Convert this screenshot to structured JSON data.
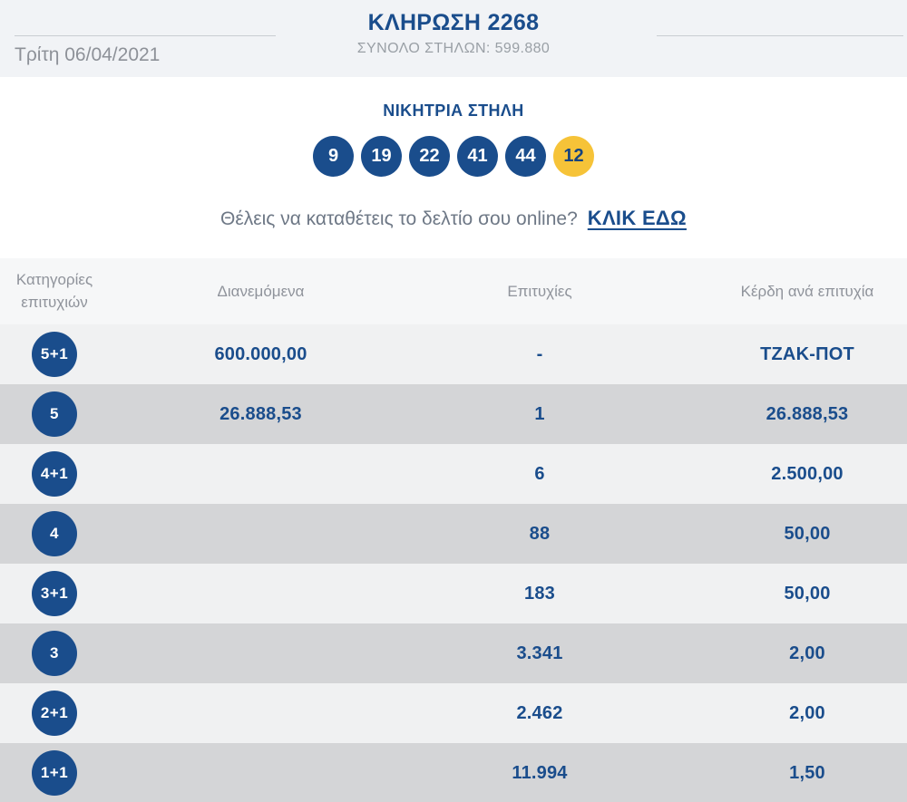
{
  "colors": {
    "brand_blue": "#1a4d8c",
    "joker_yellow": "#f6c338"
  },
  "header": {
    "title": "ΚΛΗΡΩΣΗ 2268",
    "date": "Τρίτη 06/04/2021",
    "columns_total": "ΣΥΝΟΛΟ ΣΤΗΛΩΝ: 599.880"
  },
  "winning": {
    "title": "ΝΙΚΗΤΡΙΑ ΣΤΗΛΗ",
    "numbers": [
      "9",
      "19",
      "22",
      "41",
      "44"
    ],
    "joker": "12"
  },
  "online": {
    "question": "Θέλεις να καταθέτεις το δελτίο σου online?",
    "link_label": "ΚΛΙΚ ΕΔΩ"
  },
  "table": {
    "headers": {
      "category": "Κατηγορίες επιτυχιών",
      "distributed": "Διανεμόμενα",
      "winners": "Επιτυχίες",
      "prize": "Κέρδη ανά επιτυχία"
    },
    "rows": [
      {
        "category": "5+1",
        "distributed": "600.000,00",
        "winners": "-",
        "prize": "ΤΖΑΚ-ΠΟΤ"
      },
      {
        "category": "5",
        "distributed": "26.888,53",
        "winners": "1",
        "prize": "26.888,53"
      },
      {
        "category": "4+1",
        "distributed": "",
        "winners": "6",
        "prize": "2.500,00"
      },
      {
        "category": "4",
        "distributed": "",
        "winners": "88",
        "prize": "50,00"
      },
      {
        "category": "3+1",
        "distributed": "",
        "winners": "183",
        "prize": "50,00"
      },
      {
        "category": "3",
        "distributed": "",
        "winners": "3.341",
        "prize": "2,00"
      },
      {
        "category": "2+1",
        "distributed": "",
        "winners": "2.462",
        "prize": "2,00"
      },
      {
        "category": "1+1",
        "distributed": "",
        "winners": "11.994",
        "prize": "1,50"
      }
    ]
  }
}
